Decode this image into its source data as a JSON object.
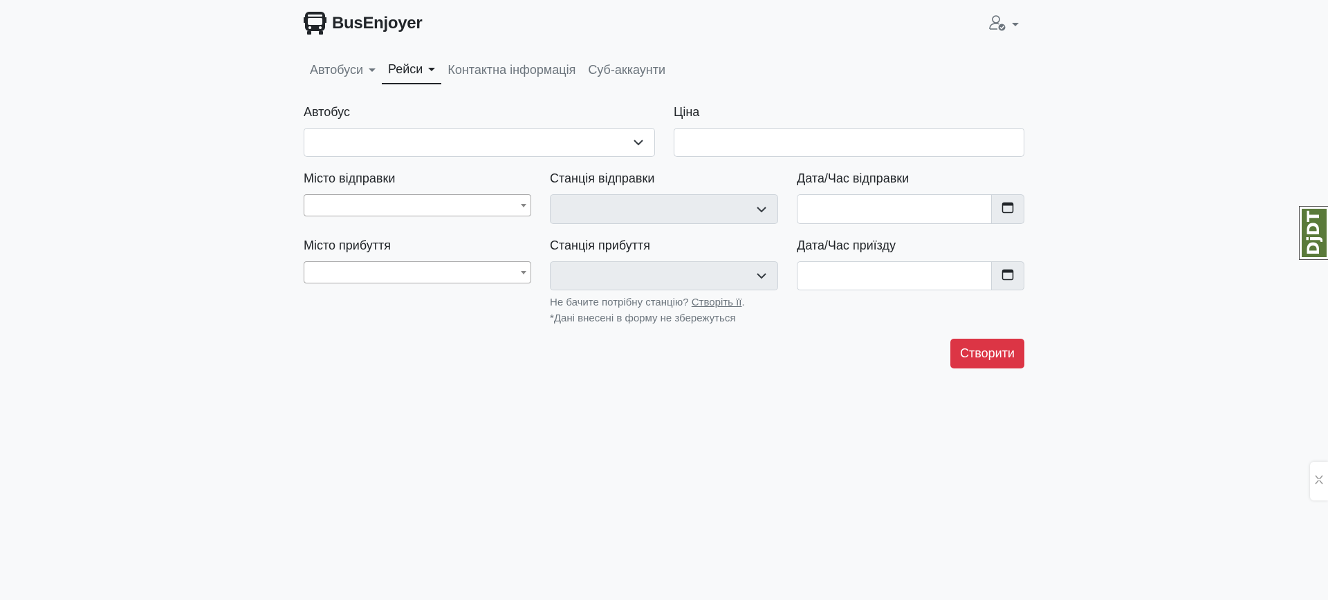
{
  "app": {
    "brand": "BusEnjoyer"
  },
  "header": {
    "user_icon": "user-check-icon"
  },
  "nav": {
    "items": [
      {
        "label": "Автобуси",
        "dropdown": true
      },
      {
        "label": "Рейси",
        "dropdown": true,
        "active": true
      },
      {
        "label": "Контактна інформація"
      },
      {
        "label": "Суб-аккаунти"
      }
    ]
  },
  "form": {
    "bus_label": "Автобус",
    "bus_value": "",
    "price_label": "Ціна",
    "price_value": "",
    "departure_city_label": "Місто відправки",
    "departure_station_label": "Станція відправки",
    "departure_datetime_label": "Дата/Час відправки",
    "arrival_city_label": "Місто прибуття",
    "arrival_station_label": "Станція прибуття",
    "arrival_datetime_label": "Дата/Час приїзду",
    "help_prefix": "Не бачите потрібну станцію?",
    "help_link": "Створіть її",
    "help_suffix": ".",
    "note": "*Дані внесені в форму не збережуться",
    "submit_label": "Створити"
  },
  "colors": {
    "accent": "#dc3545",
    "background": "#f8f9fa",
    "disabled": "#e9ecef"
  },
  "toolbar": {
    "djdt_label": "DjDT"
  }
}
